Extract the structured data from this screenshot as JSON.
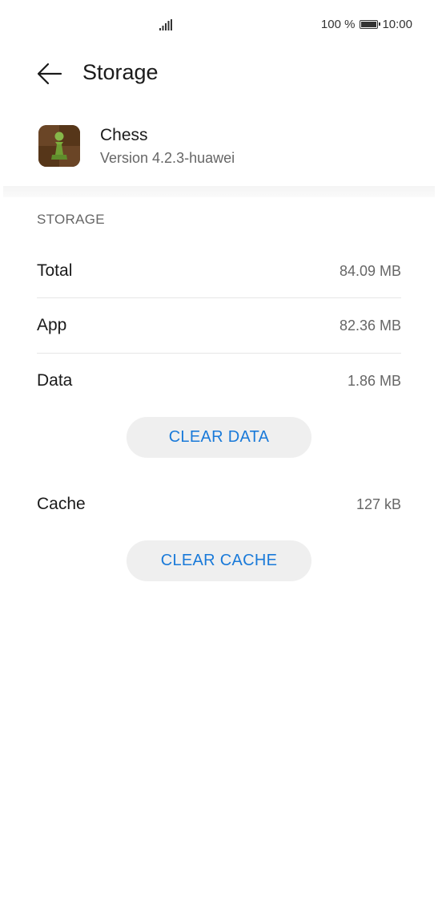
{
  "status_bar": {
    "battery_percent": "100 %",
    "time": "10:00",
    "signal_icon": "signal-icon",
    "battery_icon": "battery-icon"
  },
  "header": {
    "back_icon": "arrow-left-icon",
    "title": "Storage"
  },
  "app": {
    "name": "Chess",
    "version": "Version 4.2.3-huawei",
    "icon": "chess-pawn-icon"
  },
  "storage": {
    "section_title": "STORAGE",
    "rows": [
      {
        "label": "Total",
        "value": "84.09 MB"
      },
      {
        "label": "App",
        "value": "82.36 MB"
      },
      {
        "label": "Data",
        "value": "1.86 MB"
      }
    ],
    "clear_data_label": "CLEAR DATA",
    "cache": {
      "label": "Cache",
      "value": "127 kB"
    },
    "clear_cache_label": "CLEAR CACHE"
  },
  "colors": {
    "accent": "#1a7ad9",
    "button_bg": "#efefef",
    "secondary_text": "#666666",
    "app_icon_bg": "#5e3c20",
    "pawn": "#7cae3c"
  }
}
